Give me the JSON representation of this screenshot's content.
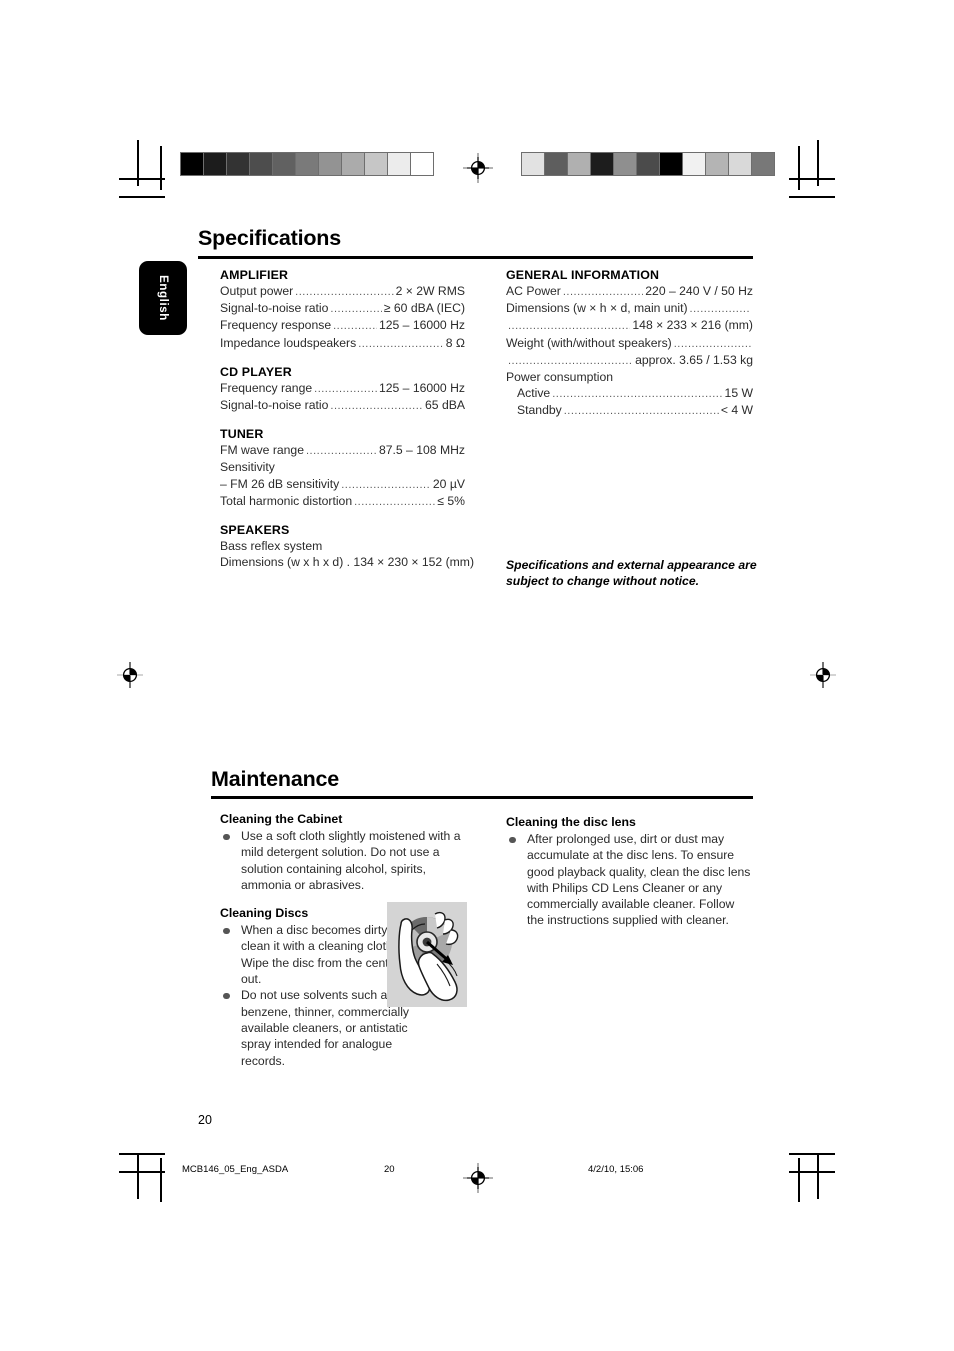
{
  "language_tab": "English",
  "specifications": {
    "title": "Specifications",
    "left_groups": [
      {
        "heading": "AMPLIFIER",
        "lines": [
          {
            "label": "Output power",
            "value": "2 × 2W RMS",
            "leader": true
          },
          {
            "label": "Signal-to-noise ratio",
            "value": "≥ 60 dBA (IEC)",
            "leader": true
          },
          {
            "label": "Frequency response",
            "value": "125 – 16000 Hz",
            "leader": true
          },
          {
            "label": "Impedance loudspeakers",
            "value": "8 Ω",
            "leader": true
          }
        ]
      },
      {
        "heading": "CD PLAYER",
        "lines": [
          {
            "label": "Frequency range",
            "value": "125 – 16000 Hz",
            "leader": true
          },
          {
            "label": "Signal-to-noise ratio",
            "value": "65 dBA",
            "leader": true
          }
        ]
      },
      {
        "heading": "TUNER",
        "lines": [
          {
            "label": "FM wave range",
            "value": "87.5 – 108 MHz",
            "leader": true
          },
          {
            "label": "Sensitivity",
            "value": "",
            "leader": false
          },
          {
            "label": "– FM 26 dB sensitivity",
            "value": "20 µV",
            "leader": true
          },
          {
            "label": "Total harmonic distortion",
            "value": "≤ 5%",
            "leader": true
          }
        ]
      },
      {
        "heading": "SPEAKERS",
        "lines": [
          {
            "label": "Bass reflex system",
            "value": "",
            "leader": false
          },
          {
            "label": "Dimensions (w x h x d) . 134 × 230 × 152 (mm)",
            "value": "",
            "leader": false
          }
        ]
      }
    ],
    "right_groups": [
      {
        "heading": "GENERAL INFORMATION",
        "lines": [
          {
            "label": "AC Power",
            "value": "220 – 240 V / 50 Hz",
            "leader": true
          },
          {
            "label": "Dimensions (w × h × d, main unit)",
            "value": "",
            "leader": true
          },
          {
            "label": "",
            "value": "148 × 233 × 216 (mm)",
            "leader": true
          },
          {
            "label": "Weight (with/without speakers)",
            "value": "",
            "leader": true
          },
          {
            "label": "",
            "value": "approx. 3.65 / 1.53 kg",
            "leader": true
          },
          {
            "label": "Power consumption",
            "value": "",
            "leader": false
          },
          {
            "label": "Active",
            "value": "15 W",
            "leader": true,
            "indent": true
          },
          {
            "label": "Standby",
            "value": "< 4 W",
            "leader": true,
            "indent": true
          }
        ]
      }
    ],
    "note": "Specifications and external appearance are subject to change without notice."
  },
  "maintenance": {
    "title": "Maintenance",
    "left_blocks": [
      {
        "heading": "Cleaning the Cabinet",
        "bullets": [
          "Use a soft cloth slightly moistened with a mild detergent solution. Do not use a solution containing alcohol, spirits, ammonia or abrasives."
        ]
      },
      {
        "heading": "Cleaning Discs",
        "bullets": [
          "When a disc becomes dirty, clean it with a cleaning cloth. Wipe the disc from the centre out.",
          "Do not use solvents such as benzene, thinner, commercially available cleaners, or antistatic spray intended for analogue records."
        ]
      }
    ],
    "right_blocks": [
      {
        "heading": "Cleaning the disc lens",
        "bullets": [
          "After prolonged use, dirt or dust may accumulate at the disc lens. To ensure good playback quality, clean the disc lens with Philips CD Lens Cleaner or any commercially available cleaner. Follow the instructions supplied with cleaner."
        ]
      }
    ],
    "figure_alt": "hand-wiping-disc-illustration"
  },
  "page_number": "20",
  "footer": {
    "filename": "MCB146_05_Eng_ASDA",
    "page": "20",
    "timestamp": "4/2/10, 15:06"
  },
  "colorbars": {
    "left": [
      "#000000",
      "#1c1c1c",
      "#333333",
      "#4d4d4d",
      "#616161",
      "#7a7a7a",
      "#939393",
      "#ababab",
      "#c6c6c6",
      "#ececec",
      "#ffffff"
    ],
    "right": [
      "#e2e2e2",
      "#5e5e5e",
      "#b0b0b0",
      "#1d1d1d",
      "#8f8f8f",
      "#4b4b4b",
      "#000000",
      "#f1f1f1",
      "#b4b4b4",
      "#d9d9d9",
      "#787878"
    ]
  }
}
